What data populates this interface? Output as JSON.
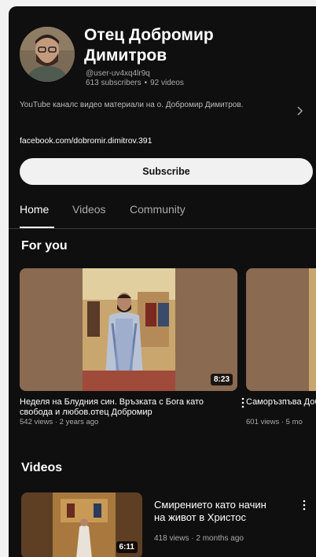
{
  "channel": {
    "name": "Отец Добромир Димитров",
    "handle": "@user-uv4xq4lr9q",
    "subscribers": "613 subscribers",
    "stats_separator": "•",
    "videos_count": "92 videos",
    "description": "YouTube каналс видео материали на о. Добромир Димитров.",
    "link": "facebook.com/dobromir.dimitrov.391"
  },
  "actions": {
    "subscribe_label": "Subscribe"
  },
  "tabs": [
    {
      "label": "Home",
      "active": true
    },
    {
      "label": "Videos",
      "active": false
    },
    {
      "label": "Community",
      "active": false
    }
  ],
  "for_you": {
    "title": "For you",
    "cards": [
      {
        "title": "Неделя на Блудния син. Връзката с Бога като свобода и любов.отец Добромир",
        "meta": "542 views · 2 years ago",
        "duration": "8:23"
      },
      {
        "title": "Саморъзпъва Добромир Ди",
        "meta": "601 views · 5 mo"
      }
    ]
  },
  "videos": {
    "title": "Videos",
    "items": [
      {
        "title": "Смирението като начин на живот в Христос",
        "meta": "418 views · 2 months ago",
        "duration": "6:11"
      }
    ]
  },
  "icons": [
    "chevron-right-icon",
    "more-vert-icon"
  ],
  "colors": {
    "background": "#0f0f0f",
    "secondary_text": "#aaaaaa",
    "subscribe_bg": "#f1f1f1"
  }
}
